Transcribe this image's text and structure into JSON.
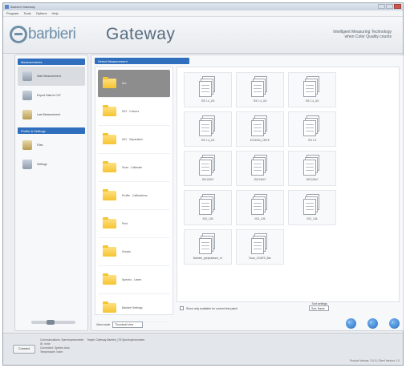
{
  "window": {
    "title": "Barbieri Gateway",
    "buttons": [
      "minimize",
      "maximize",
      "close"
    ]
  },
  "menu": [
    "Program",
    "Tools",
    "Options",
    "Help"
  ],
  "banner": {
    "brand": "barbieri",
    "product": "Gateway",
    "tagline_line1": "Intelligent Measuring Technology",
    "tagline_line2": "when Color Quality counts"
  },
  "sidebar": {
    "sections": [
      {
        "title": "Measurements",
        "items": [
          {
            "label": "Start Measurement",
            "icon": "printer-icon"
          },
          {
            "label": "Export Data to CxF",
            "icon": "export-icon"
          },
          {
            "label": "Last Measurement",
            "icon": "list-icon"
          }
        ]
      },
      {
        "title": "Profile & Settings",
        "items": [
          {
            "label": "Files",
            "icon": "folder-icon"
          },
          {
            "label": "Settings",
            "icon": "settings-icon"
          }
        ]
      }
    ]
  },
  "main": {
    "tab": "Select Measurement",
    "folders": [
      {
        "label": "ALL"
      },
      {
        "label": "ISO - Colours"
      },
      {
        "label": "ISO - Separation"
      },
      {
        "label": "Scan - Calibrate"
      },
      {
        "label": "Profile - Calibrations"
      },
      {
        "label": "Print"
      },
      {
        "label": "Scripts"
      },
      {
        "label": "Spectro - Users"
      },
      {
        "label": "Barbieri Settings"
      }
    ],
    "files": [
      {
        "name": "IT8.7-4_US"
      },
      {
        "name": "IT8.7-4_US"
      },
      {
        "name": "IT8.7-4_US"
      },
      {
        "name": "IT8.7-4_US"
      },
      {
        "name": "ECI2002_CMYK"
      },
      {
        "name": "IT8.7-3"
      },
      {
        "name": "ISO12647"
      },
      {
        "name": "ISO12647"
      },
      {
        "name": "ISO12647"
      },
      {
        "name": "ISO_126"
      },
      {
        "name": "ISO_126"
      },
      {
        "name": "ISO_126"
      },
      {
        "name": "Barbieri_greybalance_v1"
      },
      {
        "name": "Scan_CGATS_Bar"
      }
    ],
    "show_all_label": "Show only available for current test patch",
    "sort_label": "Sort settings",
    "sort_value": "Sort: Name",
    "view_label": "View mode",
    "view_value": "Thumbnail view"
  },
  "status": {
    "connect_button": "Connect",
    "info_lines": [
      [
        "Communications: Spectrophotometer",
        "Target: Gateway Barbieri_IT8 Spectrophotometer"
      ],
      [
        "ID: none"
      ],
      [
        "Connected: Spectro Auto"
      ],
      [
        "Temperature: None"
      ]
    ],
    "version": "Product Version: 3.0.0 | Client Version: 1.0"
  }
}
